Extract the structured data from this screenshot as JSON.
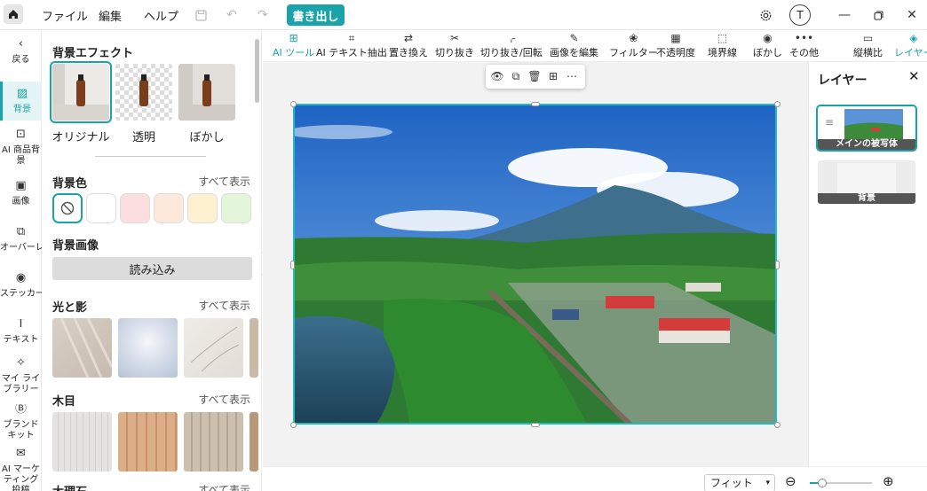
{
  "menu": {
    "file": "ファイル",
    "edit": "編集",
    "help": "ヘルプ",
    "export": "書き出し",
    "avatar": "T"
  },
  "rail": [
    {
      "label": "戻る",
      "icon": "back-icon"
    },
    {
      "label": "背景",
      "icon": "background-icon",
      "active": true
    },
    {
      "label": "AI 商品背景",
      "icon": "ai-product-bg-icon"
    },
    {
      "label": "画像",
      "icon": "image-icon"
    },
    {
      "label": "オーバーレイ",
      "icon": "overlay-icon"
    },
    {
      "label": "ステッカー",
      "icon": "sticker-icon"
    },
    {
      "label": "テキスト",
      "icon": "text-icon"
    },
    {
      "label": "マイ ライブラリー",
      "icon": "library-icon"
    },
    {
      "label": "ブランド キット",
      "icon": "brand-kit-icon"
    },
    {
      "label": "AI マーケティング投稿",
      "icon": "ai-marketing-icon"
    }
  ],
  "panel": {
    "effect_title": "背景エフェクト",
    "effects": [
      "オリジナル",
      "透明",
      "ぼかし"
    ],
    "color_title": "背景色",
    "show_all": "すべて表示",
    "colors": [
      "#ffffff",
      "#fddede",
      "#fde9dc",
      "#fdf1cf",
      "#e4f6da"
    ],
    "image_title": "背景画像",
    "import": "読み込み",
    "light_title": "光と影",
    "wood_title": "木目",
    "marble_title": "大理石"
  },
  "toolbar": [
    {
      "label": "AI ツール",
      "icon": "ai-tool-icon",
      "accent": true
    },
    {
      "label": "AI テキスト抽出",
      "icon": "ocr-icon"
    },
    {
      "label": "置き換え",
      "icon": "replace-icon"
    },
    {
      "label": "切り抜き",
      "icon": "cutout-icon"
    },
    {
      "label": "切り抜き/回転",
      "icon": "crop-rotate-icon"
    },
    {
      "label": "画像を編集",
      "icon": "edit-image-icon"
    },
    {
      "label": "フィルター",
      "icon": "filter-icon"
    },
    {
      "label": "不透明度",
      "icon": "opacity-icon"
    },
    {
      "label": "境界線",
      "icon": "border-icon"
    },
    {
      "label": "ぼかし",
      "icon": "blur-icon"
    },
    {
      "label": "その他",
      "icon": "more-icon"
    },
    {
      "label": "縦横比",
      "icon": "aspect-ratio-icon"
    },
    {
      "label": "レイヤー",
      "icon": "layers-icon",
      "accent": true
    }
  ],
  "layers": {
    "title": "レイヤー",
    "items": [
      "メインの被写体",
      "背景"
    ]
  },
  "status": {
    "zoom_mode": "フィット",
    "zoom_level": 0.2
  },
  "colors": {
    "accent": "#1aa3a8"
  }
}
